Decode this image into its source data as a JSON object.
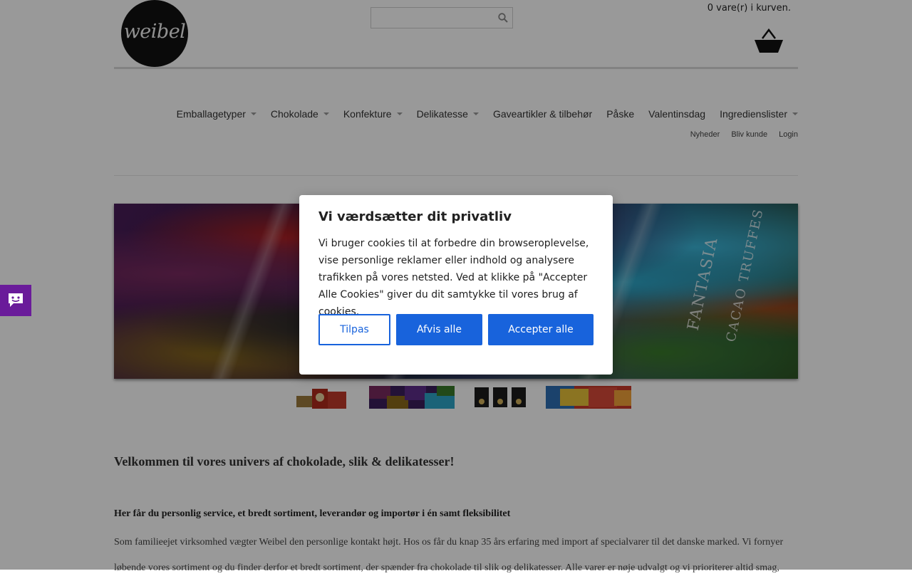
{
  "header": {
    "logo_text": "weibel",
    "search_placeholder": "",
    "cart_text": "0 vare(r) i kurven."
  },
  "nav": {
    "items": [
      {
        "label": "Emballagetyper",
        "dropdown": true
      },
      {
        "label": "Chokolade",
        "dropdown": true
      },
      {
        "label": "Konfekture",
        "dropdown": true
      },
      {
        "label": "Delikatesse",
        "dropdown": true
      },
      {
        "label": "Gaveartikler & tilbehør",
        "dropdown": false
      },
      {
        "label": "Påske",
        "dropdown": false
      },
      {
        "label": "Valentinsdag",
        "dropdown": false
      },
      {
        "label": "Ingredienslister",
        "dropdown": true
      }
    ],
    "sub_items": [
      "Nyheder",
      "Bliv kunde",
      "Login"
    ]
  },
  "slider": {
    "banner_text_1": "FANTASIA",
    "banner_text_2": "CACAO TRUFFES",
    "thumbnail_count": 4
  },
  "content": {
    "welcome_title": "Velkommen til vores univers af chokolade, slik & delikatesser!",
    "subheading": "Her får du personlig service, et bredt sortiment, leverandør og importør i én samt fleksibilitet",
    "paragraph": "Som familieejet virksomhed vægter Weibel den personlige kontakt højt. Hos os får du knap 35 års erfaring med import af specialvarer til det danske marked. Vi fornyer løbende vores sortiment og du finder derfor et bredt sortiment, der spænder fra chokolade til slik og delikatesser. Alle varer er nøje udvalgt og vi prioriterer altid smag,"
  },
  "cookie_modal": {
    "title": "Vi værdsætter dit privatliv",
    "body": "Vi bruger cookies til at forbedre din browseroplevelse, vise personlige reklamer eller indhold og analysere trafikken på vores netsted. Ved at klikke på \"Accepter Alle Cookies\" giver du dit samtykke til vores brug af cookies.",
    "customize_label": "Tilpas",
    "reject_label": "Afvis alle",
    "accept_label": "Accepter alle"
  },
  "colors": {
    "accent": "#1863dc",
    "chat_widget": "#6a1b9a",
    "overlay": "rgba(0,0,0,0.4)"
  },
  "icons": [
    "search-icon",
    "basket-icon",
    "chat-icon",
    "chevron-down-icon"
  ]
}
